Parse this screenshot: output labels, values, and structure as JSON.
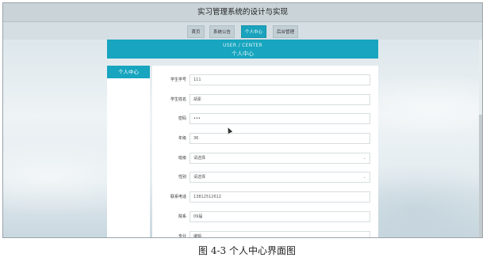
{
  "header": {
    "title": "实习管理系统的设计与实现"
  },
  "nav": {
    "items": [
      {
        "label": "首页",
        "active": false
      },
      {
        "label": "系统公告",
        "active": false
      },
      {
        "label": "个人中心",
        "active": true
      },
      {
        "label": "后台管理",
        "active": false
      }
    ]
  },
  "banner": {
    "en": "USER / CENTER",
    "cn": "个人中心"
  },
  "sidebar": {
    "items": [
      {
        "label": "个人中心"
      }
    ]
  },
  "form": {
    "fields": [
      {
        "label": "学生学号",
        "value": "111",
        "type": "text"
      },
      {
        "label": "学生姓名",
        "value": "胡素",
        "type": "text"
      },
      {
        "label": "密码",
        "value": "•••",
        "type": "password"
      },
      {
        "label": "年级",
        "value": "36",
        "type": "text"
      },
      {
        "label": "班级",
        "value": "请选择",
        "type": "select"
      },
      {
        "label": "性别",
        "value": "请选择",
        "type": "select"
      },
      {
        "label": "联系电话",
        "value": "13812512612",
        "type": "text"
      },
      {
        "label": "院系",
        "value": "09届",
        "type": "text"
      },
      {
        "label": "专业",
        "value": "编辑",
        "type": "text"
      }
    ]
  },
  "icons": {
    "select_arrow": "chevron-down-icon",
    "cursor": "mouse-pointer-icon"
  },
  "colors": {
    "accent": "#17a5bf",
    "header_bg": "#c9d3d8"
  },
  "caption": "图 4-3 个人中心界面图"
}
